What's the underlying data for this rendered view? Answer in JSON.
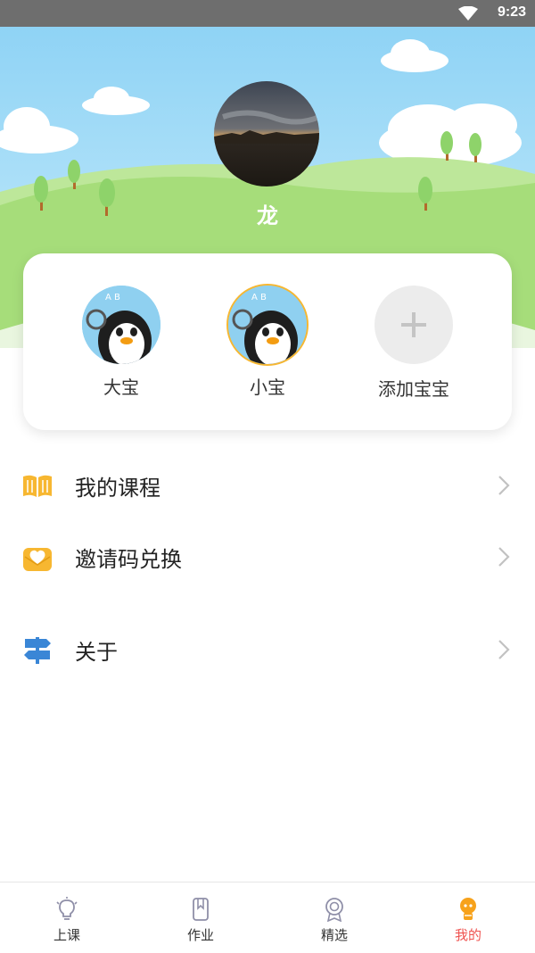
{
  "status_bar": {
    "time": "9:23"
  },
  "profile": {
    "username": "龙"
  },
  "babies": {
    "items": [
      {
        "name": "大宝"
      },
      {
        "name": "小宝"
      }
    ],
    "add_label": "添加宝宝"
  },
  "menu": {
    "items": [
      {
        "label": "我的课程",
        "icon": "book-icon"
      },
      {
        "label": "邀请码兑换",
        "icon": "envelope-heart-icon"
      },
      {
        "label": "关于",
        "icon": "signpost-icon"
      }
    ]
  },
  "tabs": [
    {
      "label": "上课",
      "icon": "lightbulb-icon"
    },
    {
      "label": "作业",
      "icon": "bookmark-icon"
    },
    {
      "label": "精选",
      "icon": "medal-icon"
    },
    {
      "label": "我的",
      "icon": "profile-icon",
      "active": true
    }
  ],
  "colors": {
    "accent_active": "#ef5350",
    "menu_icon_yellow": "#f7b731",
    "menu_icon_blue": "#3a86d6",
    "sky": "#8fd3f5",
    "grass": "#a6dd7a"
  }
}
